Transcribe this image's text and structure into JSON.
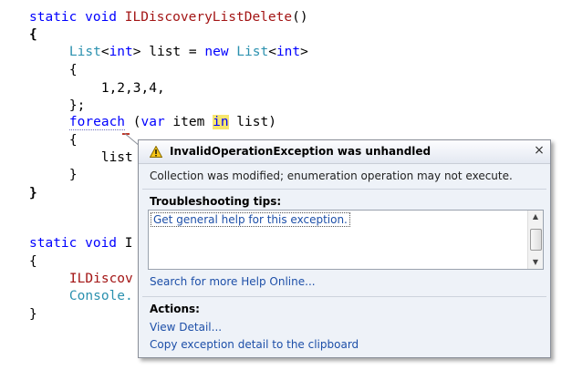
{
  "code": {
    "l1": {
      "kw": "static void ",
      "name": "ILDiscoveryListDelete",
      "rest": "()"
    },
    "l2": "{",
    "l3": {
      "indent": "    ",
      "t1": "List",
      "a": "<",
      "t2": "int",
      "b": "> list = ",
      "kw": "new ",
      "t3": "List",
      "c": "<",
      "t4": "int",
      "d": ">"
    },
    "l4": "    {",
    "l5": "        1,2,3,4,",
    "l6": "    };",
    "l7": {
      "indent": "    ",
      "kw": "foreach",
      "sp": " (",
      "var": "var",
      "mid": " item ",
      "in": "in",
      "end": " list)"
    },
    "l8": "    {",
    "l9": "        list",
    "l10": "    }",
    "l11": "}",
    "l12": {
      "kw": "static void ",
      "rest": "I"
    },
    "l13": "{",
    "l14": {
      "indent": "    ",
      "name": "ILDiscov"
    },
    "l15": {
      "indent": "    ",
      "name": "Console."
    },
    "l16": "}"
  },
  "exception": {
    "title": "InvalidOperationException was unhandled",
    "message": "Collection was modified; enumeration operation may not execute.",
    "tips_heading": "Troubleshooting tips:",
    "tip_link": "Get general help for this exception.",
    "search_link": "Search for more Help Online...",
    "actions_heading": "Actions:",
    "action_view": "View Detail...",
    "action_copy": "Copy exception detail to the clipboard",
    "close_glyph": "×",
    "icon": "warning-triangle-icon"
  },
  "colors": {
    "keyword": "#0000ff",
    "type": "#2b91af",
    "method": "#a31515",
    "highlight": "#f7e66e",
    "link": "#1d4fa8"
  }
}
